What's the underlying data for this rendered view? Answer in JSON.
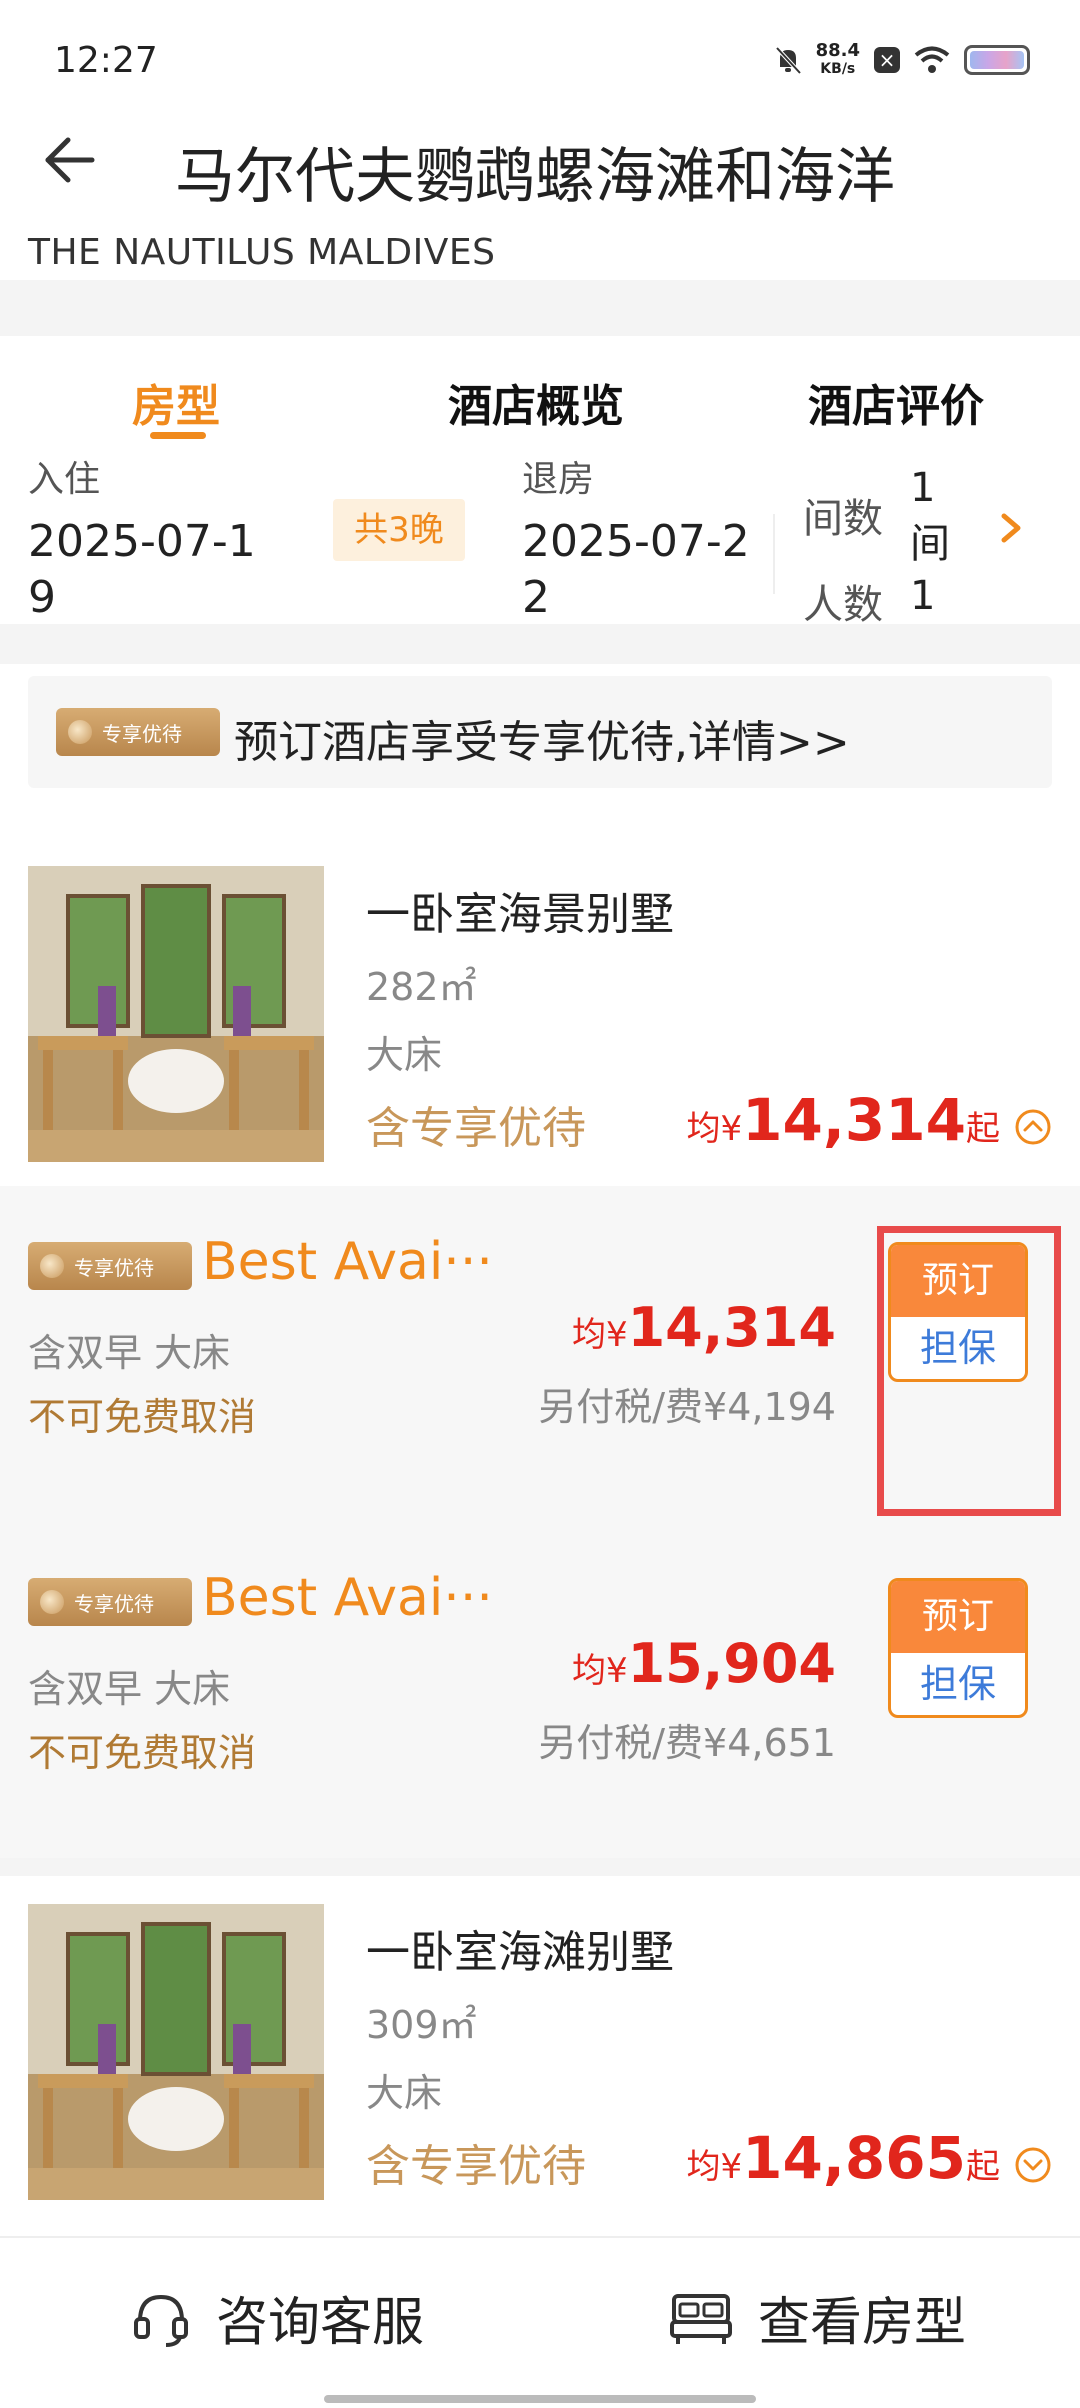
{
  "status_bar": {
    "time": "12:27",
    "net_speed_value": "88.4",
    "net_speed_unit": "KB/s",
    "icons": [
      "mute-bell-icon",
      "close-box-icon",
      "wifi-icon",
      "battery-icon"
    ]
  },
  "header": {
    "title": "马尔代夫鹦鹉螺海滩和海洋",
    "subtitle": "THE NAUTILUS MALDIVES"
  },
  "tabs": [
    {
      "label": "房型",
      "active": true
    },
    {
      "label": "酒店概览",
      "active": false
    },
    {
      "label": "酒店评价",
      "active": false
    }
  ],
  "stay": {
    "checkin_label": "入住",
    "checkin_date": "2025-07-19",
    "nights": "共3晚",
    "checkout_label": "退房",
    "checkout_date": "2025-07-22",
    "rooms_label": "间数",
    "rooms_value": "1间",
    "guests_label": "人数",
    "guests_value": "1"
  },
  "promo": {
    "badge": "专享优待",
    "text": "预订酒店享受专享优待,详情>>"
  },
  "rooms": [
    {
      "name": "一卧室海景别墅",
      "size": "282㎡",
      "bed": "大床",
      "perk": "含专享优待",
      "price_prefix": "均¥",
      "price": "14,314",
      "price_suffix": "起",
      "expanded": true,
      "rates": [
        {
          "badge": "专享优待",
          "name": "Best Avai···",
          "meal": "含双早 大床",
          "cancel": "不可免费取消",
          "price_prefix": "均¥",
          "price": "14,314",
          "tax": "另付税/费¥4,194",
          "book_label": "预订",
          "guarantee_label": "担保"
        },
        {
          "badge": "专享优待",
          "name": "Best Avai···",
          "meal": "含双早 大床",
          "cancel": "不可免费取消",
          "price_prefix": "均¥",
          "price": "15,904",
          "tax": "另付税/费¥4,651",
          "book_label": "预订",
          "guarantee_label": "担保"
        }
      ]
    },
    {
      "name": "一卧室海滩别墅",
      "size": "309㎡",
      "bed": "大床",
      "perk": "含专享优待",
      "price_prefix": "均¥",
      "price": "14,865",
      "price_suffix": "起",
      "expanded": false
    }
  ],
  "bottom_bar": {
    "service_label": "咨询客服",
    "rooms_label": "查看房型"
  },
  "colors": {
    "accent": "#f08a1d",
    "price_red": "#e1261c",
    "gold": "#c8975a",
    "blue": "#3d7bd9",
    "highlight": "#e84b4b"
  }
}
